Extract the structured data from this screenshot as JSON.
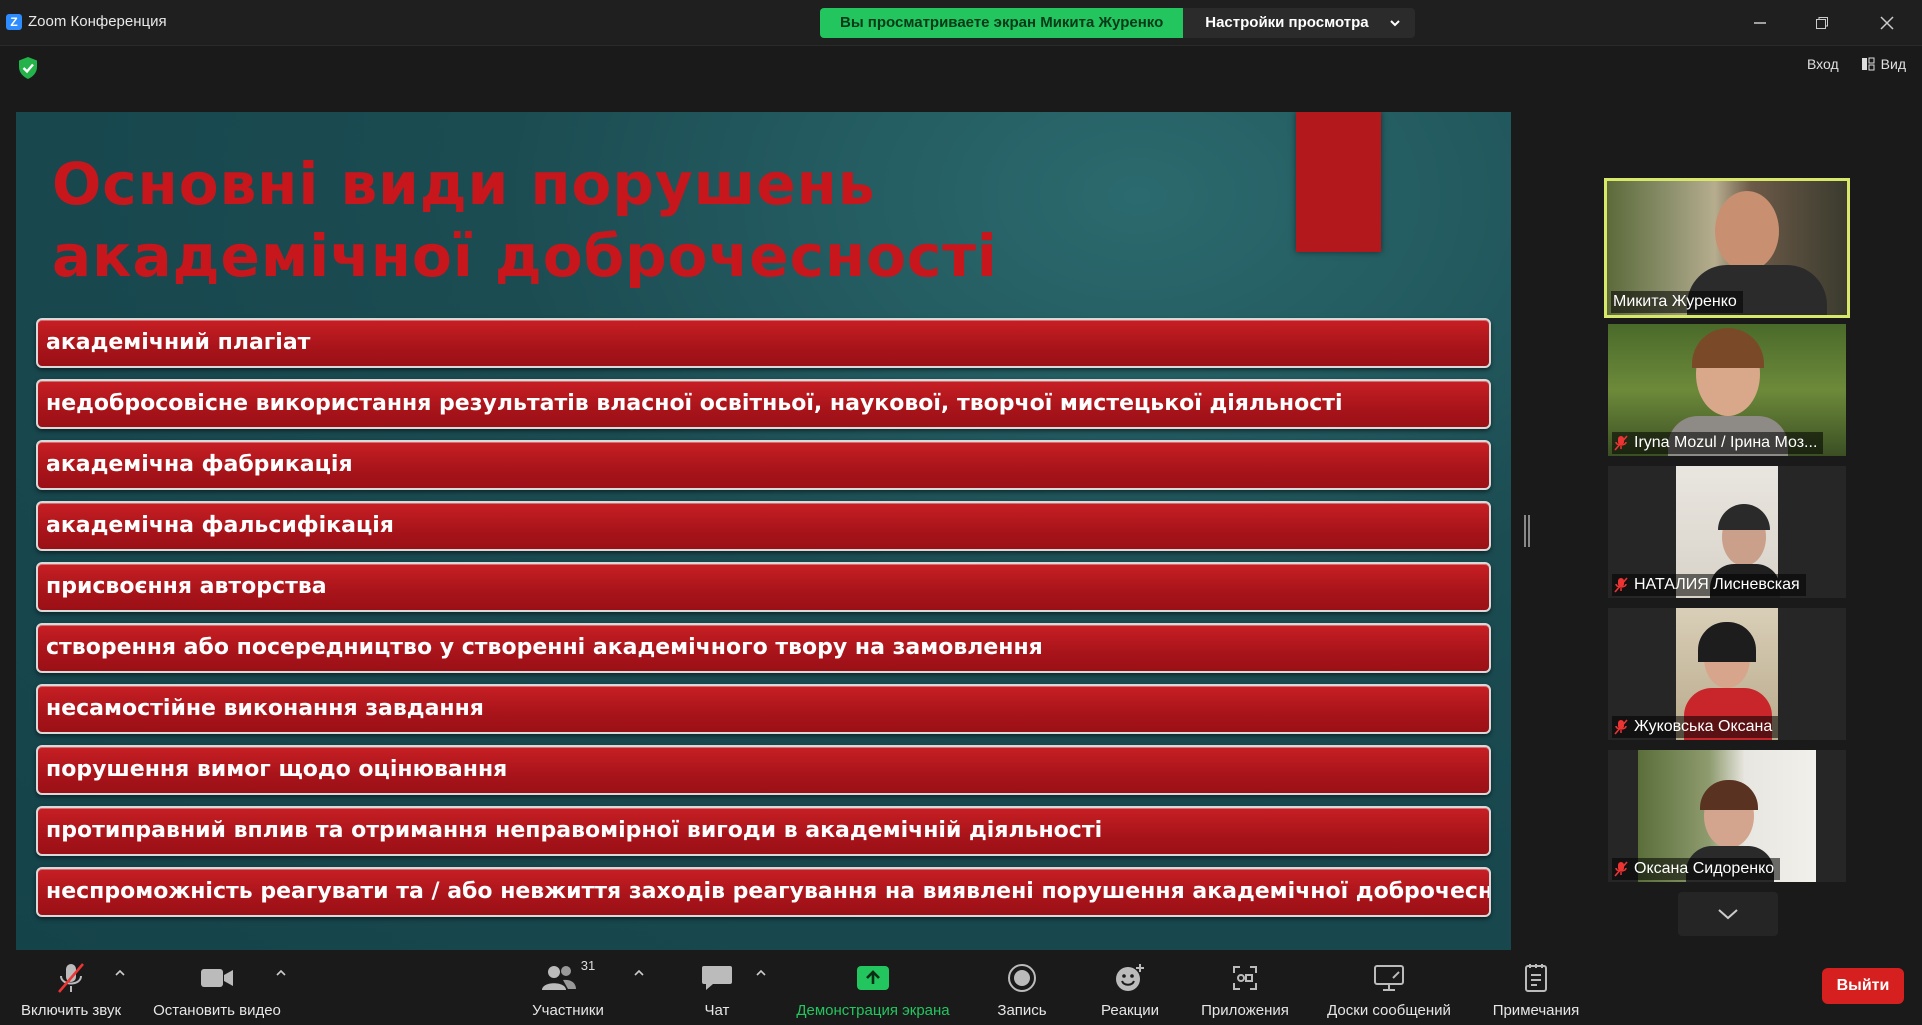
{
  "window": {
    "title": "Zoom Конференция"
  },
  "share_banner": {
    "viewing_text": "Вы просматриваете экран Микита Журенко",
    "view_options": "Настройки просмотра"
  },
  "top_right": {
    "enter_label": "Вход",
    "view_label": "Вид"
  },
  "slide": {
    "title_line1": "Основні види порушень",
    "title_line2": "академічної доброчесності",
    "items": [
      "академічний плагіат",
      "недобросовісне використання результатів власної освітньої, наукової, творчої мистецької діяльності",
      "академічна фабрикація",
      "академічна фальсифікація",
      "присвоєння авторства",
      "створення або посередництво у створенні академічного твору на замовлення",
      "несамостійне виконання завдання",
      "порушення вимог щодо оцінювання",
      "протиправний вплив та отримання неправомірної вигоди в академічній діяльності",
      "неспроможність реагувати та / або невжиття заходів реагування на виявлені порушення академічної доброчесності"
    ]
  },
  "participants": [
    {
      "name": "Микита Журенко",
      "muted": false,
      "active_speaker": true
    },
    {
      "name": "Iryna Mozul / Ірина Моз...",
      "muted": true,
      "active_speaker": false
    },
    {
      "name": "НАТАЛИЯ Лисневская",
      "muted": true,
      "active_speaker": false
    },
    {
      "name": "Жуковська Оксана",
      "muted": true,
      "active_speaker": false
    },
    {
      "name": "Оксана Сидоренко",
      "muted": true,
      "active_speaker": false
    }
  ],
  "toolbar": {
    "unmute": "Включить звук",
    "stop_video": "Остановить видео",
    "participants": "Участники",
    "participants_count": "31",
    "chat": "Чат",
    "share_screen": "Демонстрация экрана",
    "record": "Запись",
    "reactions": "Реакции",
    "apps": "Приложения",
    "whiteboards": "Доски сообщений",
    "notes": "Примечания",
    "leave": "Выйти"
  },
  "colors": {
    "accent_green": "#23c55e",
    "slide_red": "#c8161d",
    "leave_red": "#d61f1f",
    "speaker_border": "#d7e86a"
  }
}
